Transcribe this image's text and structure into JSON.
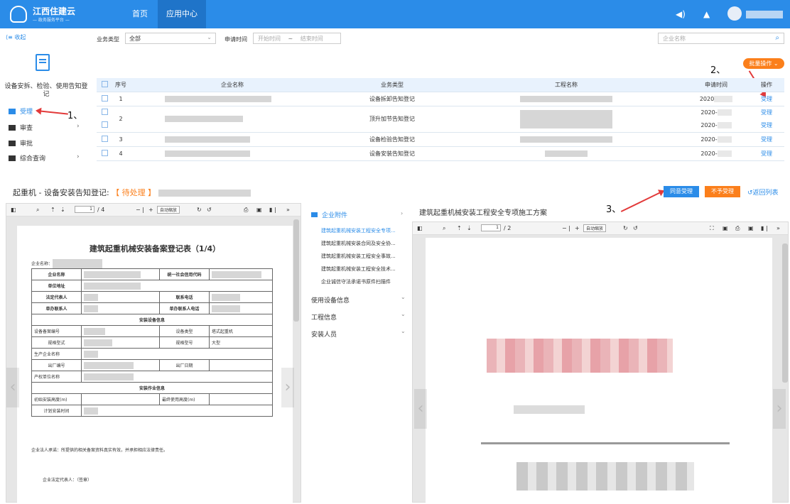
{
  "header": {
    "logo_title": "江西住建云",
    "logo_subtitle": "— 政务服务平台 —",
    "nav": [
      "首页",
      "应用中心"
    ],
    "active_nav": "应用中心",
    "icons": [
      "speaker-icon",
      "bell-icon",
      "avatar"
    ]
  },
  "sidebar": {
    "collapse_label": "收起",
    "title": "设备安拆、检验、使用告知登记",
    "items": [
      {
        "label": "受理",
        "active": true
      },
      {
        "label": "审查",
        "has_children": true
      },
      {
        "label": "审批"
      },
      {
        "label": "综合查询",
        "has_children": true
      }
    ]
  },
  "filters": {
    "type_label": "业务类型",
    "type_value": "全部",
    "date_label": "申请时间",
    "start_placeholder": "开始时间",
    "separator": "~",
    "end_placeholder": "结束时间",
    "company_placeholder": "企业名称"
  },
  "batch_label": "批量操作",
  "annotations": [
    "1、",
    "2、",
    "3、"
  ],
  "table": {
    "headers": [
      "序号",
      "企业名称",
      "业务类型",
      "工程名称",
      "申请时间",
      "操作"
    ],
    "rows": [
      {
        "no": "1",
        "type": "设备拆卸告知登记",
        "date": "2020",
        "action": "受理"
      },
      {
        "no": "2",
        "type": "顶升加节告知登记",
        "date": "2020-",
        "action": "受理",
        "date2": "2020-",
        "action2": "受理"
      },
      {
        "no": "3",
        "type": "设备检验告知登记",
        "date": "2020-",
        "action": "受理"
      },
      {
        "no": "4",
        "type": "设备安装告知登记",
        "date": "2020-",
        "action": "受理"
      }
    ]
  },
  "detail": {
    "title": "起重机 - 设备安装告知登记:",
    "status": "【 待处理 】",
    "agree_label": "同意受理",
    "reject_label": "不予受理",
    "back_label": "返回列表",
    "colors": {
      "agree": "#2b8ce8",
      "reject": "#fb7f1b"
    }
  },
  "pdf_left": {
    "page": "1",
    "total": "/ 4",
    "zoom": "自动缩放",
    "form_title": "建筑起重机械安装备案登记表（1/4）",
    "company_label": "企业名称：",
    "rows": {
      "name": "企业名称",
      "code": "统一社会信用代码",
      "address": "单位地址",
      "legal": "法定代表人",
      "tel": "联系电话",
      "contact": "单办联系人",
      "contact_tel": "单办联系人电话",
      "section1": "安装设备信息",
      "device_no": "设备备案编号",
      "device_type": "设备类型",
      "device_type_value": "塔式起重机",
      "spec": "规格型式",
      "model": "规格型号",
      "model_value": "大型",
      "maker": "生产企业名称",
      "factory_no": "出厂编号",
      "factory_date": "出厂日期",
      "owner": "产权单位名称",
      "section2": "安装作业信息",
      "init_height": "初始安装高度(m)",
      "max_height": "最终使用高度(m)",
      "plan_time": "计划安装时间"
    },
    "pledge": "企业法人承诺：所提供的相关备案资料真实有效，并承担相应法律责任。",
    "sign": "企业法定代表人：（签章）"
  },
  "attachments": {
    "head": "企业附件",
    "items": [
      "建筑起重机械安装工程安全专项...",
      "建筑起重机械安装合同及安全协...",
      "建筑起重机械安装工程安全事故...",
      "建筑起重机械安装工程安全技术...",
      "企业诚信守法承诺书原件扫描件"
    ],
    "groups": [
      "使用设备信息",
      "工程信息",
      "安装人员"
    ]
  },
  "pdf_right": {
    "title": "建筑起重机械安装工程安全专项施工方案",
    "page": "1",
    "total": "/ 2",
    "zoom": "自动缩放"
  }
}
